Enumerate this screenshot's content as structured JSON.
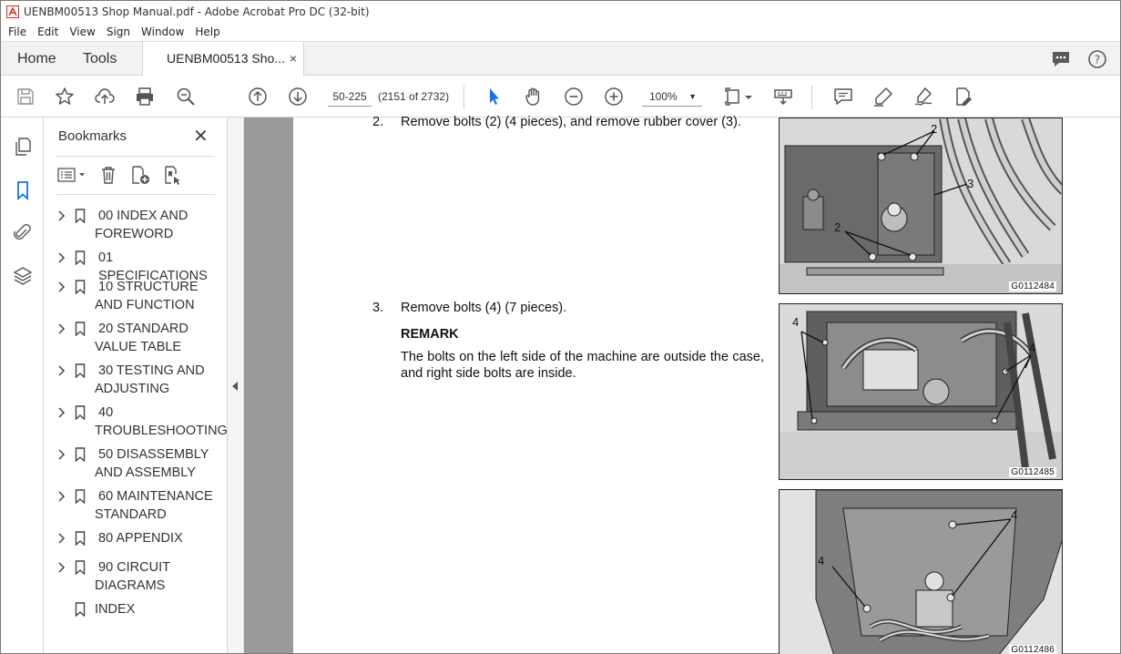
{
  "window": {
    "title": "UENBM00513 Shop Manual.pdf - Adobe Acrobat Pro DC (32-bit)"
  },
  "menu": [
    "File",
    "Edit",
    "View",
    "Sign",
    "Window",
    "Help"
  ],
  "tabs": {
    "home": "Home",
    "tools": "Tools",
    "document": "UENBM00513 Sho...",
    "close": "×"
  },
  "toolbar": {
    "page_field": "50-225",
    "page_count": "(2151 of 2732)",
    "zoom": "100%"
  },
  "bookmarks": {
    "title": "Bookmarks",
    "close": "✕",
    "items": [
      {
        "label": "00 INDEX AND FOREWORD",
        "line1": "00 INDEX AND",
        "line2": "FOREWORD",
        "has_children": true
      },
      {
        "label": "01 SPECIFICATIONS",
        "line1": "01 SPECIFICATIONS",
        "line2": "",
        "has_children": true
      },
      {
        "label": "10 STRUCTURE AND FUNCTION",
        "line1": "10 STRUCTURE",
        "line2": "AND FUNCTION",
        "has_children": true
      },
      {
        "label": "20 STANDARD VALUE TABLE",
        "line1": "20 STANDARD",
        "line2": "VALUE TABLE",
        "has_children": true
      },
      {
        "label": "30 TESTING AND ADJUSTING",
        "line1": "30 TESTING AND",
        "line2": "ADJUSTING",
        "has_children": true
      },
      {
        "label": "40 TROUBLESHOOTING",
        "line1": "40",
        "line2": "TROUBLESHOOTING",
        "has_children": true
      },
      {
        "label": "50 DISASSEMBLY AND ASSEMBLY",
        "line1": "50 DISASSEMBLY",
        "line2": "AND ASSEMBLY",
        "has_children": true
      },
      {
        "label": "60 MAINTENANCE STANDARD",
        "line1": "60 MAINTENANCE",
        "line2": "STANDARD",
        "has_children": true
      },
      {
        "label": "80 APPENDIX",
        "line1": "80 APPENDIX",
        "line2": "",
        "has_children": true
      },
      {
        "label": "90 CIRCUIT DIAGRAMS",
        "line1": "90 CIRCUIT",
        "line2": "DIAGRAMS",
        "has_children": true
      },
      {
        "label": "INDEX",
        "line1": "INDEX",
        "line2": "",
        "has_children": false
      }
    ]
  },
  "document": {
    "steps": [
      {
        "num": "2.",
        "text": "Remove bolts (2) (4 pieces), and remove rubber cover (3)."
      },
      {
        "num": "3.",
        "text": "Remove bolts (4) (7 pieces)."
      }
    ],
    "remark_title": "REMARK",
    "remark_text": "The bolts on the left side of the machine are outside the case, and right side bolts are inside.",
    "figures": [
      {
        "caption": "G0112484",
        "callouts": [
          "2",
          "3",
          "2"
        ]
      },
      {
        "caption": "G0112485",
        "callouts": [
          "4",
          "4"
        ]
      },
      {
        "caption": "G0112486",
        "callouts": [
          "4",
          "4"
        ]
      }
    ]
  },
  "icons": {
    "title": "acrobat-logo-icon",
    "colors": {
      "acrobat_red": "#d7281e",
      "accent_blue": "#1473e6",
      "icon_gray": "#5a5a5a"
    }
  }
}
